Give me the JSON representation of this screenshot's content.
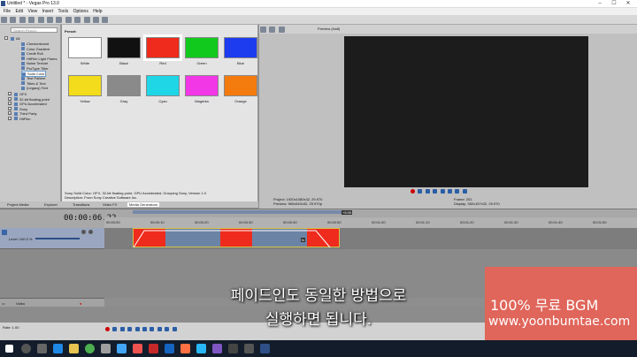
{
  "app": {
    "title": "Untitled * - Vegas Pro 13.0"
  },
  "menu": [
    "File",
    "Edit",
    "View",
    "Insert",
    "Tools",
    "Options",
    "Help"
  ],
  "media_tree": {
    "search_placeholder": "Search Plug-In",
    "root": "All",
    "items": [
      "Checkerboard",
      "Color Gradient",
      "Credit Roll",
      "HitFilm Light Flares",
      "Noise Texture",
      "ProType Titler",
      "Solid Color",
      "Test Pattern",
      "Titles & Text",
      "(Legacy) Text"
    ],
    "groups": [
      "OFX",
      "32-bit floating point",
      "GPU Accelerated",
      "Sony",
      "Third Party",
      "HitFilm"
    ],
    "selected": "Solid Color"
  },
  "preset": {
    "label": "Preset:",
    "swatches": [
      {
        "name": "White",
        "color": "#ffffff"
      },
      {
        "name": "Black",
        "color": "#111111"
      },
      {
        "name": "Red",
        "color": "#ee2b1d"
      },
      {
        "name": "Green",
        "color": "#11c91d"
      },
      {
        "name": "Blue",
        "color": "#1d3cf0"
      },
      {
        "name": "Yellow",
        "color": "#f2dc1b"
      },
      {
        "name": "Gray",
        "color": "#8a8a8a"
      },
      {
        "name": "Cyan",
        "color": "#1ed6e6"
      },
      {
        "name": "Magenta",
        "color": "#f238e6"
      },
      {
        "name": "Orange",
        "color": "#f47b0e"
      }
    ],
    "selected": "Red",
    "description_1": "Sony Solid Color: OFX, 32-bit floating point, GPU Accelerated, Grouping Sony, Version 1.0",
    "description_2": "Description: From Sony Creative Software Inc."
  },
  "tabs": [
    "Project Media",
    "Explorer",
    "Transitions",
    "Video FX",
    "Media Generators"
  ],
  "active_tab": "Media Generators",
  "preview": {
    "label": "Preview (Half)",
    "project": "Project: 1920x1080x32, 29.970",
    "preview_res": "Preview: 960x540x32, 29.970p",
    "frame": "Frame: 201",
    "display": "Display: 352x157x32, 29.970"
  },
  "timeline": {
    "timecode": "00:00:06.22",
    "ruler": [
      "00:00:00",
      "00:00:10",
      "00:00:20",
      "00:00:30",
      "00:00:40",
      "00:00:50",
      "00:01:00",
      "00:01:10",
      "00:01:20",
      "00:01:30",
      "00:01:40",
      "00:01:50"
    ],
    "marker": "+5:05",
    "track1_level": "Level: 100.0 %",
    "track2_label": "Video",
    "rate": "Rate: 1.00"
  },
  "subtitle": {
    "line1": "페이드인도 동일한 방법으로",
    "line2": "실행하면 됩니다."
  },
  "promo": {
    "line1": "100% 무료 BGM",
    "line2": "www.yoonbumtae.com"
  }
}
